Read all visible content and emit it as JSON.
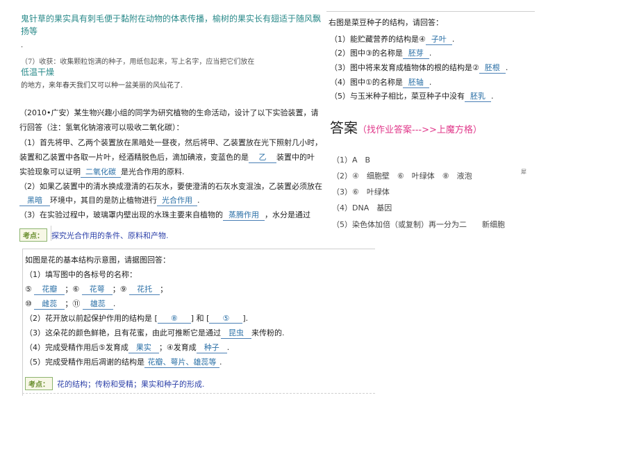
{
  "top_left": {
    "line1": "鬼针草的果实具有刺毛便于黏附在动物的体表传播，榆树的果实长有翅适于随风飘",
    "line2": "扬等",
    "dot": ".",
    "line3": "（7）收获：收集颗粒饱满的种子，用纸包起来，写上名字，应当把它们放在",
    "line4": "低温干燥",
    "line5": "的地方，来年春天我们又可以种一盆美丽的风仙花了."
  },
  "seed": {
    "title": "右图是菜豆种子的结构，请回答：",
    "q1_pre": "（1）能贮藏营养的结构是④",
    "q1_ans": "子叶",
    "q1_post": ".",
    "q2_pre": "（2）图中③的名称是",
    "q2_ans": "胚芽",
    "q2_post": ".",
    "q3_pre": "（3）图中将来发育成植物体的根的结构是②",
    "q3_ans": "胚根",
    "q3_post": ".",
    "q4_pre": "（4）图中①的名称是",
    "q4_ans": "胚轴",
    "q4_post": ".",
    "q5_pre": "（5）与玉米种子相比，菜豆种子中没有",
    "q5_ans": "胚乳",
    "q5_post": "."
  },
  "experiment": {
    "intro1": "（2010•广安）某生物兴趣小组的同学为研究植物的生命活动，设计了以下实验装置，请",
    "intro2": "行回答（注：氢氧化钠溶液可以吸收二氧化碳）：",
    "l1": "（1）首先将甲、乙两个装置放在黑暗处一昼夜，然后将甲、乙装置放在光下照射几小时，",
    "l2_pre": "装置和乙装置中各取一片叶，经酒精脱色后，滴加碘液，变蓝色的是",
    "l2_ans": "乙",
    "l2_post": "装置中的叶",
    "l3_pre": "实验现象可以证明",
    "l3_ans": "二氧化碳",
    "l3_post": "是光合作用的原料.",
    "l4": "（2）如果乙装置中的清水换成澄清的石灰水，要使澄清的石灰水变混浊，乙装置必须放在",
    "l5_ans1": "黑暗",
    "l5_mid": "环境中，其目的是防止植物进行",
    "l5_ans2": "光合作用",
    "l5_post": ".",
    "l6_pre": "（3）在实验过程中，玻璃罩内壁出现的水珠主要来自植物的",
    "l6_ans": "蒸腾作用",
    "l6_post": "，水分是通过",
    "kd_label": "考点：",
    "kd_text": "探究光合作用的条件、原料和产物."
  },
  "answers": {
    "title": "答案",
    "link": "（找作业答案--->>上魔方格）",
    "a1": "（1）A　B",
    "a2": "（2）④　细胞壁　⑥　叶绿体　⑧　液泡",
    "a3": "（3）⑥　叶绿体",
    "a4": "（4）DNA　基因",
    "a5": "（5）染色体加倍（或复制）再一分为二　　新细胞",
    "side_char": "犀"
  },
  "flower": {
    "title": "如图是花的基本结构示意图，请据图回答：",
    "q1": "（1）填写图中的各标号的名称：",
    "r1_a": "⑤",
    "r1_ans1": "花瓣",
    "r1_b": "；⑥",
    "r1_ans2": "花萼",
    "r1_c": "；⑨",
    "r1_ans3": "花托",
    "r1_d": "；",
    "r2_a": "⑩",
    "r2_ans1": "雌蕊",
    "r2_b": "；⑪",
    "r2_ans2": "雄蕊",
    "r2_c": ".",
    "q2_pre": "（2）花开放以前起保护作用的结构是 [",
    "q2_ans1": "⑧",
    "q2_mid": "] 和 [",
    "q2_ans2": "⑤",
    "q2_post": "].",
    "q3_pre": "（3）这朵花的颜色鲜艳，且有花蜜，由此可推断它是通过",
    "q3_ans": "昆虫",
    "q3_post": "来传粉的.",
    "q4_pre": "（4）完成受精作用后⑤发育成",
    "q4_ans1": "果实",
    "q4_mid": "；④发育成",
    "q4_ans2": "种子",
    "q4_post": ".",
    "q5_pre": "（5）完成受精作用后凋谢的结构是",
    "q5_ans": "花瓣、萼片、雄蕊等",
    "q5_post": ".",
    "kd_label": "考点：",
    "kd_text": "花的结构；传粉和受精；果实和种子的形成."
  }
}
